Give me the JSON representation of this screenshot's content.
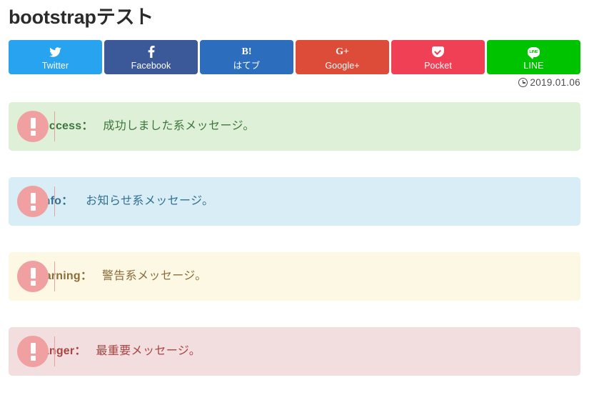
{
  "page": {
    "title": "bootstrapテスト"
  },
  "share_buttons": [
    {
      "id": "twitter",
      "label": "Twitter",
      "icon": "twitter-bird-icon",
      "color": "#28a3ef"
    },
    {
      "id": "facebook",
      "label": "Facebook",
      "icon": "facebook-f-icon",
      "color": "#3b5998"
    },
    {
      "id": "hatena",
      "label": "はてブ",
      "icon": "hatena-b-icon",
      "mark": "B!",
      "color": "#2c6ebd"
    },
    {
      "id": "google",
      "label": "Google+",
      "icon": "google-plus-icon",
      "mark": "G+",
      "color": "#dd4b39"
    },
    {
      "id": "pocket",
      "label": "Pocket",
      "icon": "pocket-icon",
      "color": "#ef4056"
    },
    {
      "id": "line",
      "label": "LINE",
      "icon": "line-chat-icon",
      "mark": "LINE",
      "color": "#00c300"
    }
  ],
  "date": {
    "icon": "clock-icon",
    "text": "2019.01.06"
  },
  "alerts": [
    {
      "type": "success",
      "label": "Success",
      "colon": "：",
      "message": "成功しました系メッセージ。",
      "bg": "#dff0d8",
      "fg": "#3c763d",
      "badge_icon": "exclamation-circle-icon"
    },
    {
      "type": "info",
      "label": "Info",
      "colon": "：",
      "message": "お知らせ系メッセージ。",
      "bg": "#d9edf7",
      "fg": "#31708f",
      "badge_icon": "exclamation-circle-icon"
    },
    {
      "type": "warning",
      "label": "Warning",
      "colon": "：",
      "message": "警告系メッセージ。",
      "bg": "#fcf8e3",
      "fg": "#8a6d3b",
      "badge_icon": "exclamation-circle-icon"
    },
    {
      "type": "danger",
      "label": "Danger",
      "colon": "：",
      "message": "最重要メッセージ。",
      "bg": "#f2dede",
      "fg": "#a94442",
      "badge_icon": "exclamation-circle-icon"
    }
  ]
}
